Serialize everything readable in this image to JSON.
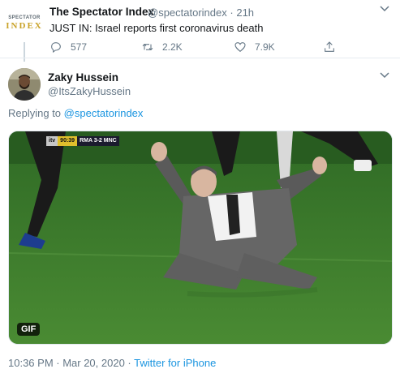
{
  "parent_tweet": {
    "logo_top": "SPECTATOR",
    "logo_bottom": "INDEX",
    "name": "The Spectator Index",
    "handle": "@spectatorindex",
    "separator": "·",
    "time": "21h",
    "text": "JUST IN: Israel reports first coronavirus death",
    "replies": "577",
    "retweets": "2.2K",
    "likes": "7.9K"
  },
  "main_tweet": {
    "name": "Zaky Hussein",
    "handle": "@ItsZakyHussein",
    "replying_prefix": "Replying to ",
    "replying_to": "@spectatorindex",
    "media": {
      "badge": "GIF",
      "score_channel": "itv",
      "score_time": "90:39",
      "score_text": "RMA 3-2 MNC"
    },
    "timestamp": "10:36 PM · Mar 20, 2020",
    "dot": " · ",
    "source": "Twitter for iPhone"
  },
  "colors": {
    "accent": "#1b95e0",
    "secondary_text": "#657786",
    "pitch": "#3e7a2c"
  },
  "icons": [
    "reply-icon",
    "retweet-icon",
    "like-icon",
    "share-icon",
    "chevron-down-icon"
  ]
}
